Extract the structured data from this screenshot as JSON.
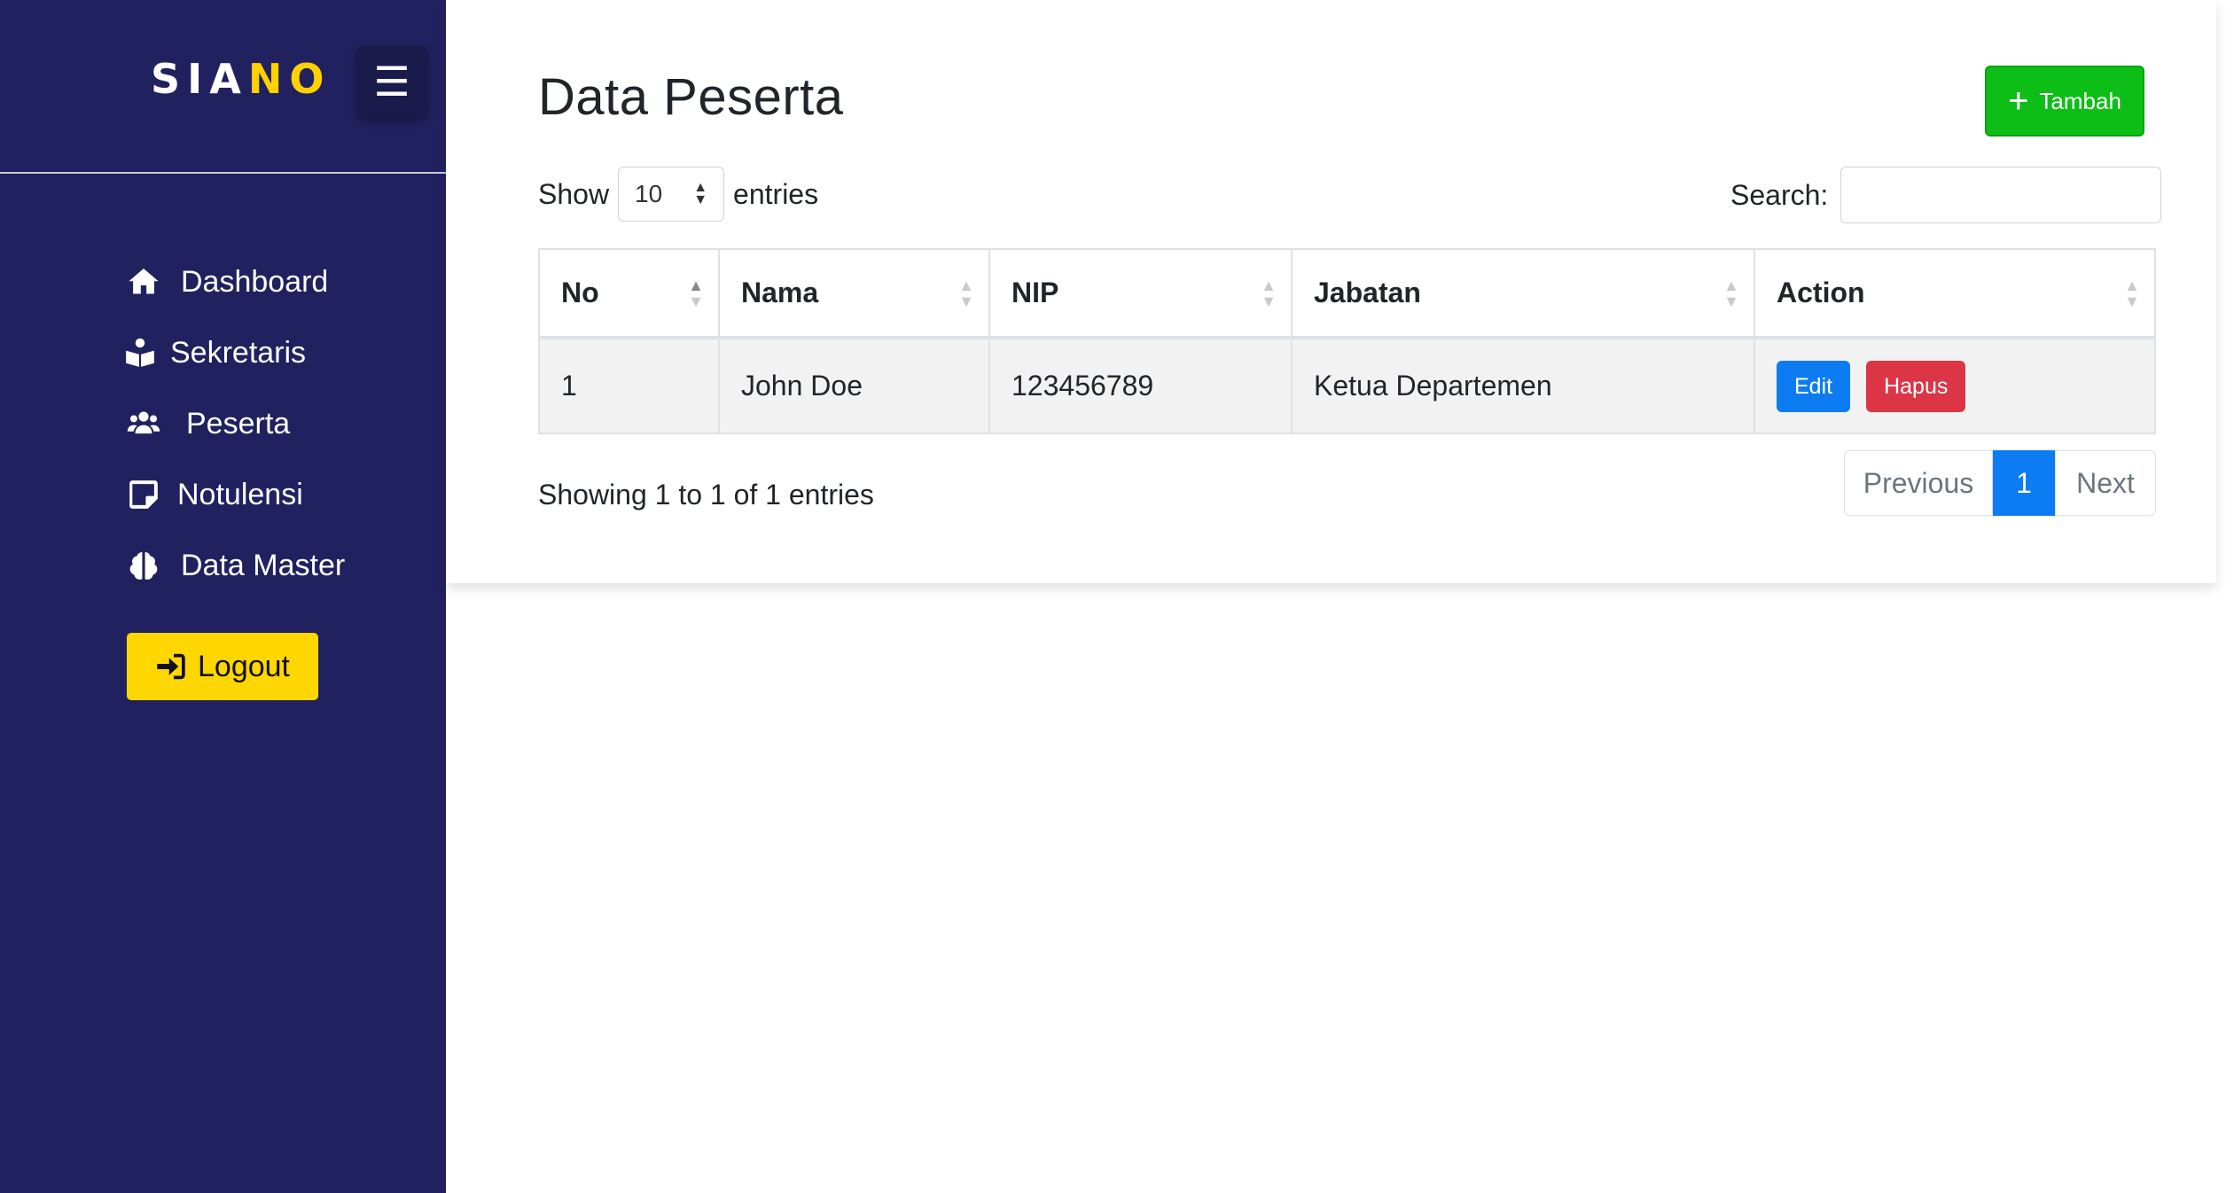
{
  "sidebar": {
    "brand_part1": "SIA",
    "brand_part2": "NO",
    "toggle_glyph": "☰",
    "nav": [
      {
        "label": "Dashboard",
        "icon": "home-icon"
      },
      {
        "label": "Sekretaris",
        "icon": "user-book-icon"
      },
      {
        "label": "Peserta",
        "icon": "users-icon"
      },
      {
        "label": "Notulensi",
        "icon": "note-icon"
      },
      {
        "label": "Data Master",
        "icon": "brain-icon"
      }
    ],
    "logout_label": "Logout",
    "colors": {
      "background": "#21215f",
      "accent": "#ffd100"
    }
  },
  "main": {
    "title": "Data Peserta",
    "add_button_label": "Tambah",
    "length": {
      "show_label": "Show",
      "value": "10",
      "entries_label": "entries"
    },
    "search": {
      "label": "Search:",
      "value": "",
      "placeholder": ""
    },
    "table": {
      "columns": [
        "No",
        "Nama",
        "NIP",
        "Jabatan",
        "Action"
      ],
      "rows": [
        {
          "no": "1",
          "nama": "John Doe",
          "nip": "123456789",
          "jabatan": "Ketua Departemen",
          "edit_label": "Edit",
          "delete_label": "Hapus"
        }
      ]
    },
    "info": "Showing 1 to 1 of 1 entries",
    "pagination": {
      "previous": "Previous",
      "current": "1",
      "next": "Next"
    },
    "colors": {
      "add": "#0dbe17",
      "edit": "#0d7cf2",
      "delete": "#dc3546",
      "logout": "#ffd700"
    }
  }
}
